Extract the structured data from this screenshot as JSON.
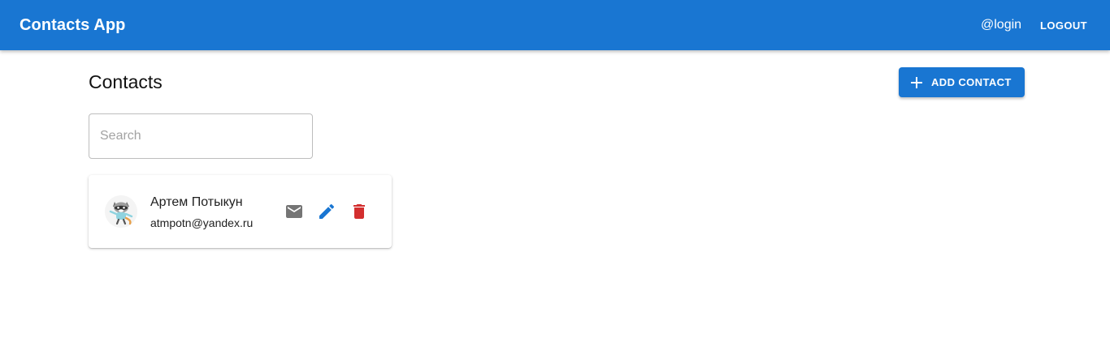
{
  "header": {
    "title": "Contacts App",
    "login": "@login",
    "logout_label": "LOGOUT",
    "color": "#1976d2"
  },
  "page": {
    "title": "Contacts",
    "add_button_label": "ADD CONTACT"
  },
  "search": {
    "placeholder": "Search",
    "value": ""
  },
  "contacts": [
    {
      "name": "Артем Потыкун",
      "email": "atmpotn@yandex.ru",
      "avatar": "raccoon-avatar",
      "actions": [
        "mail-icon",
        "edit-icon",
        "delete-icon"
      ]
    }
  ],
  "colors": {
    "primary": "#1976d2",
    "mail_icon": "#757575",
    "edit_icon": "#1976d2",
    "delete_icon": "#d32f2f"
  }
}
